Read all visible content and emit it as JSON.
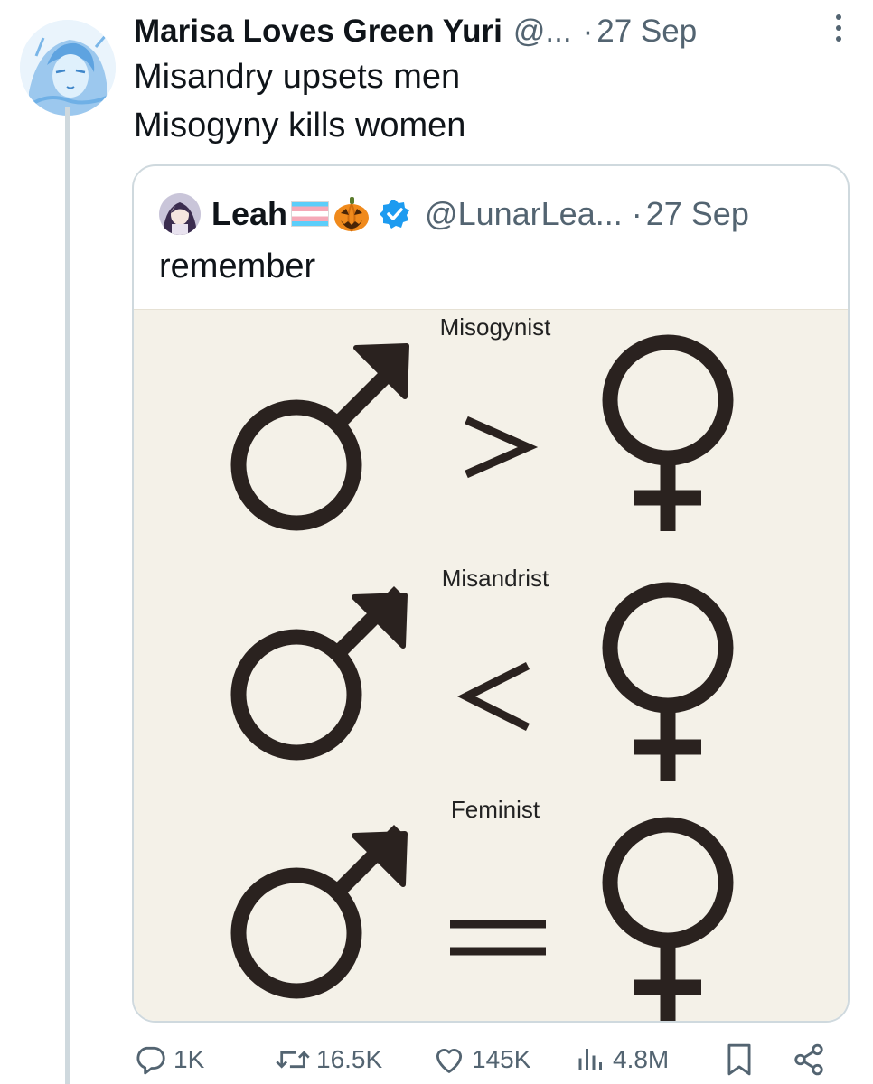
{
  "tweet": {
    "display_name": "Marisa Loves Green Yuri",
    "handle": "@...",
    "date": "27 Sep",
    "separator": "·",
    "lines": [
      "Misandry upsets men",
      "Misogyny kills women"
    ],
    "avatar_icon": "anime-avatar-icon",
    "thread_color": "#cfd9de"
  },
  "quote": {
    "display_name": "Leah",
    "emoji": [
      "transgender-flag-icon",
      "jack-o-lantern-icon"
    ],
    "verified": true,
    "verified_color": "#1d9bf0",
    "handle": "@LunarLea...",
    "separator": "·",
    "date": "27 Sep",
    "text": "remember",
    "media": {
      "background": "#f4f1e8",
      "symbol_color": "#2a221f",
      "rows": [
        {
          "label": "Misogynist",
          "left": "male-symbol-icon",
          "operator": ">",
          "right": "female-symbol-icon"
        },
        {
          "label": "Misandrist",
          "left": "male-symbol-icon",
          "operator": "<",
          "right": "female-symbol-icon"
        },
        {
          "label": "Feminist",
          "left": "male-symbol-icon",
          "operator": "=",
          "right": "female-symbol-icon"
        }
      ]
    }
  },
  "actions": {
    "reply": {
      "icon": "reply-icon",
      "count": "1K"
    },
    "retweet": {
      "icon": "retweet-icon",
      "count": "16.5K"
    },
    "like": {
      "icon": "heart-icon",
      "count": "145K"
    },
    "views": {
      "icon": "views-icon",
      "count": "4.8M"
    },
    "bookmark": {
      "icon": "bookmark-icon"
    },
    "share": {
      "icon": "share-icon"
    }
  }
}
